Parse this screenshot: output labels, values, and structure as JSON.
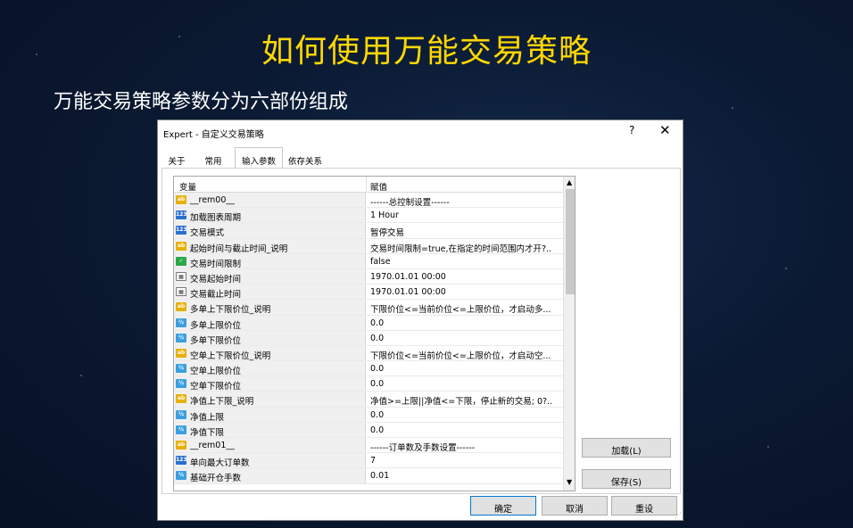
{
  "slide": {
    "title": "如何使用万能交易策略",
    "subtitle": "万能交易策略参数分为六部份组成"
  },
  "dialog": {
    "title": "Expert - 自定义交易策略",
    "help_label": "?",
    "close_label": "✕",
    "tabs": [
      {
        "label": "关于"
      },
      {
        "label": "常用"
      },
      {
        "label": "输入参数",
        "active": true
      },
      {
        "label": "依存关系"
      }
    ],
    "grid": {
      "col_variable": "变量",
      "col_value": "赋值",
      "rows": [
        {
          "type": "ab",
          "name": "__rem00__",
          "value": "------总控制设置------"
        },
        {
          "type": "123",
          "name": "加载图表周期",
          "value": "1 Hour"
        },
        {
          "type": "123",
          "name": "交易模式",
          "value": "暂停交易"
        },
        {
          "type": "ab",
          "name": "起始时间与截止时间_说明",
          "value": "交易时间限制=true,在指定的时间范围内才开?.."
        },
        {
          "type": "bool",
          "name": "交易时间限制",
          "value": "false"
        },
        {
          "type": "dt",
          "name": "交易起始时间",
          "value": "1970.01.01 00:00"
        },
        {
          "type": "dt",
          "name": "交易截止时间",
          "value": "1970.01.01 00:00"
        },
        {
          "type": "ab",
          "name": "多单上下限价位_说明",
          "value": "下限价位<=当前价位<=上限价位，才启动多..."
        },
        {
          "type": "dbl",
          "name": "多单上限价位",
          "value": "0.0"
        },
        {
          "type": "dbl",
          "name": "多单下限价位",
          "value": "0.0"
        },
        {
          "type": "ab",
          "name": "空单上下限价位_说明",
          "value": "下限价位<=当前价位<=上限价位，才启动空..."
        },
        {
          "type": "dbl",
          "name": "空单上限价位",
          "value": "0.0"
        },
        {
          "type": "dbl",
          "name": "空单下限价位",
          "value": "0.0"
        },
        {
          "type": "ab",
          "name": "净值上下限_说明",
          "value": "净值>=上限||净值<=下限，停止新的交易; 0?.."
        },
        {
          "type": "dbl",
          "name": "净值上限",
          "value": "0.0"
        },
        {
          "type": "dbl",
          "name": "净值下限",
          "value": "0.0"
        },
        {
          "type": "ab",
          "name": "__rem01__",
          "value": "------订单数及手数设置------"
        },
        {
          "type": "123",
          "name": "单向最大订单数",
          "value": "7"
        },
        {
          "type": "dbl",
          "name": "基础开仓手数",
          "value": "0.01"
        }
      ]
    },
    "buttons": {
      "load": "加载(L)",
      "save": "保存(S)",
      "ok": "确定",
      "cancel": "取消",
      "reset": "重设"
    }
  },
  "icons": {
    "ab": "ab",
    "123": "123",
    "bool": "✓",
    "dt": "▦",
    "dbl": "½"
  }
}
